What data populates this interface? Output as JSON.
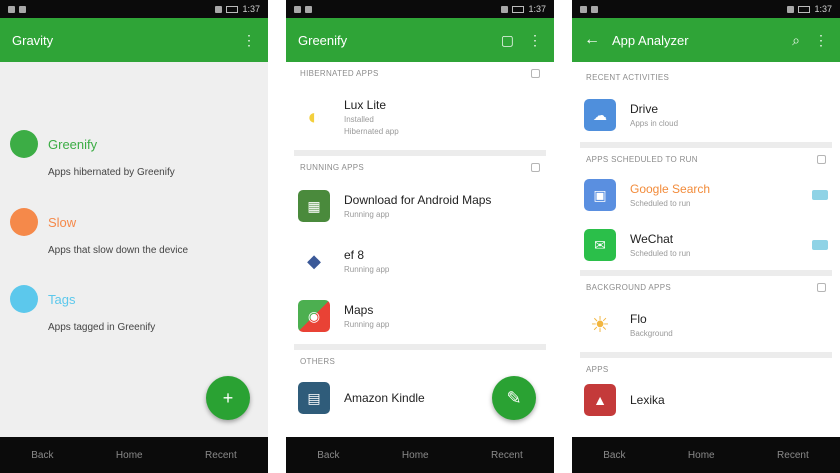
{
  "colors": {
    "app_bar": "#2fa437",
    "fab": "#2aa233",
    "legend_green": "#3cad45",
    "legend_orange": "#f5894a",
    "legend_blue": "#5cc8ec",
    "highlight_orange": "#f28b3a"
  },
  "screen1": {
    "title": "Gravity",
    "legend": [
      {
        "label": "Greenify",
        "desc": "Apps hibernated by Greenify",
        "color": "#3cad45"
      },
      {
        "label": "Slow",
        "desc": "Apps that slow down the device",
        "color": "#f5894a"
      },
      {
        "label": "Tags",
        "desc": "Apps tagged in Greenify",
        "color": "#5cc8ec"
      }
    ],
    "fab_icon": "add-icon"
  },
  "screen2": {
    "title": "Greenify",
    "sections": [
      {
        "label": "HIBERNATED APPS",
        "items": [
          {
            "name": "Lux Lite",
            "sub": "Installed",
            "sub2": "Hibernated app",
            "icon": "lux-icon",
            "color": "#f3cf3c"
          }
        ]
      },
      {
        "label": "RUNNING APPS",
        "items": [
          {
            "name": "Download for Android Maps",
            "sub": "Running app",
            "icon": "map-download-icon",
            "color": "#4a8a3c"
          },
          {
            "name": "ef 8",
            "sub": "Running app",
            "icon": "ef-icon",
            "color": "#3b5998"
          },
          {
            "name": "Maps",
            "sub": "Running app",
            "icon": "maps-icon",
            "color": "#4caf50"
          }
        ]
      },
      {
        "label": "OTHERS",
        "items": [
          {
            "name": "Amazon Kindle",
            "sub": "",
            "icon": "kindle-icon",
            "color": "#2f5c7a"
          }
        ]
      }
    ],
    "fab_icon": "edit-icon"
  },
  "screen3": {
    "title": "App Analyzer",
    "sections": [
      {
        "label": "RECENT ACTIVITIES",
        "items": [
          {
            "name": "Drive",
            "sub": "Apps in cloud",
            "icon": "drive-icon",
            "color": "#4f8fdc",
            "orange": false,
            "toggle": false
          }
        ]
      },
      {
        "label": "APPS SCHEDULED TO RUN",
        "items": [
          {
            "name": "Google Search",
            "sub": "Scheduled to run",
            "icon": "google-search-icon",
            "color": "#5a8fe0",
            "orange": true,
            "toggle": true
          },
          {
            "name": "WeChat",
            "sub": "Scheduled to run",
            "icon": "wechat-icon",
            "color": "#2bbf4a",
            "orange": false,
            "toggle": true
          }
        ]
      },
      {
        "label": "BACKGROUND APPS",
        "items": [
          {
            "name": "Flo",
            "sub": "Background",
            "icon": "sun-icon",
            "color": "#f2b640",
            "orange": false,
            "toggle": false
          }
        ]
      },
      {
        "label": "APPS",
        "items": [
          {
            "name": "Lexika",
            "sub": "",
            "icon": "lexika-icon",
            "color": "#c43a3a",
            "orange": false,
            "toggle": false
          }
        ]
      }
    ]
  },
  "status_bar": {
    "time": "1:37"
  },
  "nav_bar": {
    "back": "Back",
    "home": "Home",
    "recent": "Recent"
  }
}
